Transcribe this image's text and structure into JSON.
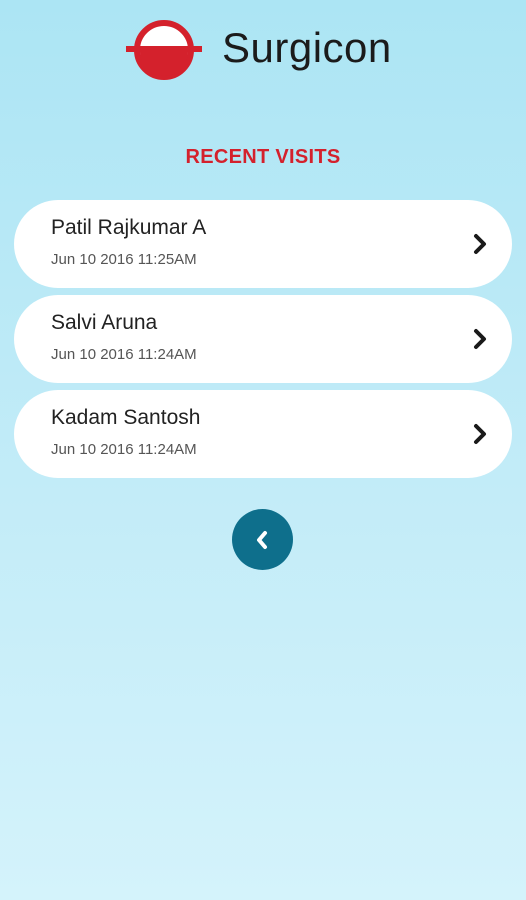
{
  "app": {
    "title": "Surgicon"
  },
  "recent_visits": {
    "heading": "RECENT VISITS",
    "items": [
      {
        "name": "Patil Rajkumar A",
        "datetime": "Jun 10 2016 11:25AM"
      },
      {
        "name": "Salvi Aruna",
        "datetime": "Jun 10 2016 11:24AM"
      },
      {
        "name": "Kadam Santosh",
        "datetime": "Jun 10 2016 11:24AM"
      }
    ]
  },
  "icons": {
    "logo": "surgicon-logo",
    "item_action": "chevron-right-icon",
    "back": "chevron-left-icon"
  },
  "colors": {
    "brand_red": "#d4212c",
    "back_button": "#0e6f8c",
    "background_top": "#ace5f4",
    "background_bottom": "#d4f3fb"
  }
}
